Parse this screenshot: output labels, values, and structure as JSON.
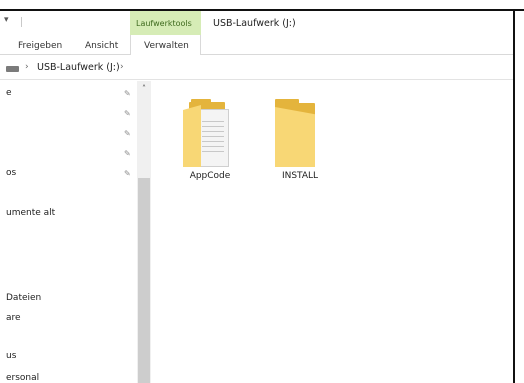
{
  "window": {
    "title": "USB-Laufwerk (J:)",
    "context_tab_group": "Laufwerktools"
  },
  "ribbon": {
    "tabs": [
      {
        "label": "Freigeben"
      },
      {
        "label": "Ansicht"
      },
      {
        "label": "Verwalten"
      }
    ]
  },
  "address_bar": {
    "path": "USB-Laufwerk (J:)",
    "separator": "›"
  },
  "nav_pane": {
    "items": [
      {
        "label": "e",
        "pinned": true
      },
      {
        "label": "",
        "pinned": true
      },
      {
        "label": "",
        "pinned": true
      },
      {
        "label": "",
        "pinned": true
      },
      {
        "label": "os",
        "pinned": true
      },
      {
        "label": "umente alt",
        "pinned": false
      },
      {
        "label": "Dateien",
        "pinned": false
      },
      {
        "label": "are",
        "pinned": false
      },
      {
        "label": "us",
        "pinned": false
      },
      {
        "label": "ersonal",
        "pinned": false
      }
    ]
  },
  "files": [
    {
      "name": "AppCode",
      "type": "folder-with-documents"
    },
    {
      "name": "INSTALL",
      "type": "folder"
    }
  ],
  "colors": {
    "context_tab_bg": "#d6ecb6",
    "folder_front": "#f8d775",
    "folder_back": "#e4b43c"
  }
}
